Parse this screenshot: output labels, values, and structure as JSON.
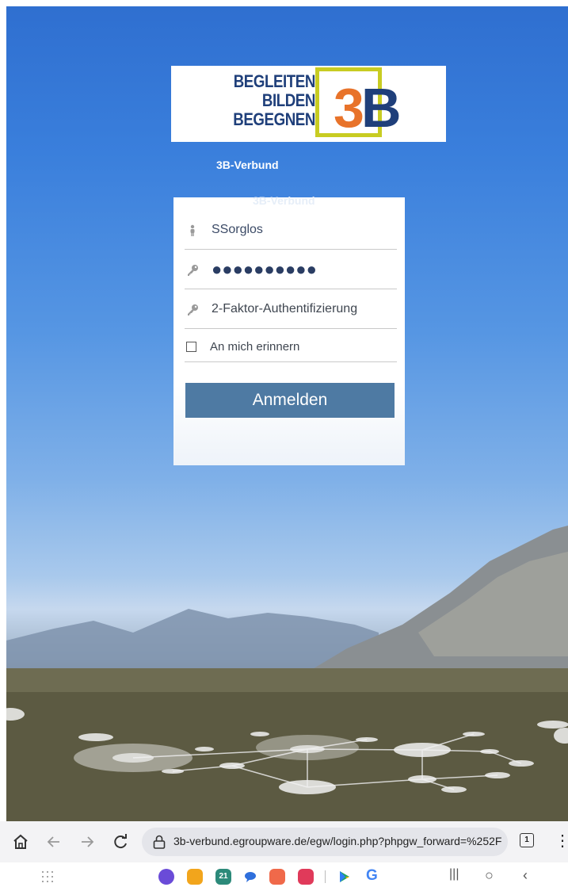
{
  "logo": {
    "lines": [
      "BEGLEITEN",
      "BILDEN",
      "BEGEGNEN"
    ],
    "mark_three": "3",
    "mark_b": "B"
  },
  "site_name": "3B-Verbund",
  "ghost_title": "3B-Verbund",
  "login": {
    "username_value": "SSorglos",
    "password_dots": "●●●●●●●●●●",
    "twofactor_placeholder": "2-Faktor-Authentifizierung",
    "remember_label": "An mich erinnern",
    "submit_label": "Anmelden"
  },
  "browser": {
    "url": "3b-verbund.egroupware.de/egw/login.php?phpgw_forward=%252F",
    "tab_count": "1"
  },
  "navbar": {
    "calendar_day": "21"
  },
  "colors": {
    "brand_blue": "#1f3f7a",
    "brand_orange": "#e8732a",
    "brand_yellow": "#c8cc22",
    "button": "#4e7aa3"
  }
}
